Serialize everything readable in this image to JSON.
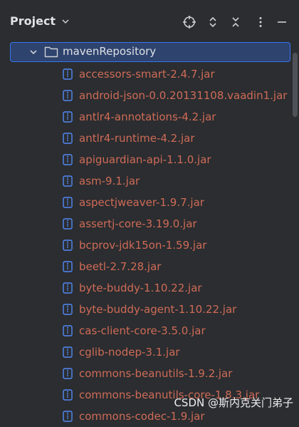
{
  "panel": {
    "title": "Project"
  },
  "toolbar": {
    "icons": [
      "crosshair-icon",
      "expand-collapse-icon",
      "collapse-all-icon",
      "more-icon",
      "minimize-icon"
    ]
  },
  "tree": {
    "root": {
      "label": "mavenRepository",
      "expanded": true,
      "selected": true
    },
    "items": [
      {
        "label": "accessors-smart-2.4.7.jar"
      },
      {
        "label": "android-json-0.0.20131108.vaadin1.jar"
      },
      {
        "label": "antlr4-annotations-4.2.jar"
      },
      {
        "label": "antlr4-runtime-4.2.jar"
      },
      {
        "label": "apiguardian-api-1.1.0.jar"
      },
      {
        "label": "asm-9.1.jar"
      },
      {
        "label": "aspectjweaver-1.9.7.jar"
      },
      {
        "label": "assertj-core-3.19.0.jar"
      },
      {
        "label": "bcprov-jdk15on-1.59.jar"
      },
      {
        "label": "beetl-2.7.28.jar"
      },
      {
        "label": "byte-buddy-1.10.22.jar"
      },
      {
        "label": "byte-buddy-agent-1.10.22.jar"
      },
      {
        "label": "cas-client-core-3.5.0.jar"
      },
      {
        "label": "cglib-nodep-3.1.jar"
      },
      {
        "label": "commons-beanutils-1.9.2.jar"
      },
      {
        "label": "commons-beanutils-core-1.8.3.jar"
      },
      {
        "label": "commons-codec-1.9.jar"
      }
    ]
  },
  "watermark": {
    "text": "CSDN @斯内克关门弟子"
  },
  "colors": {
    "background": "#2b2d30",
    "selection": "#2e436e",
    "jar_text": "#cf6b57",
    "text": "#dfe1e5",
    "icon_blue": "#548af7"
  }
}
